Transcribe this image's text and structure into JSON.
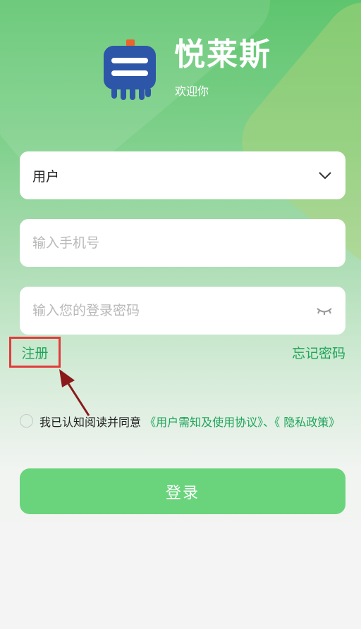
{
  "app": {
    "title": "悦莱斯",
    "subtitle": "欢迎你"
  },
  "form": {
    "role_value": "用户",
    "phone_placeholder": "输入手机号",
    "password_placeholder": "输入您的登录密码"
  },
  "links": {
    "register": "注册",
    "forgot_password": "忘记密码"
  },
  "agreement": {
    "prefix": "我已认知阅读并同意 ",
    "user_agreement": "《用户需知及使用协议》",
    "separator": "、",
    "privacy_policy": "《 隐私政策》"
  },
  "login_button": "登录",
  "icons": {
    "logo": "ticket-robot-logo",
    "dropdown": "chevron-down-icon",
    "password_toggle": "eye-closed-icon",
    "annotation": "arrow-icon"
  },
  "colors": {
    "primary_green": "#6ad47c",
    "link_green": "#1fa55a",
    "highlight_red": "#e23b3b",
    "logo_blue": "#2d56a8",
    "logo_orange": "#e8652b"
  }
}
